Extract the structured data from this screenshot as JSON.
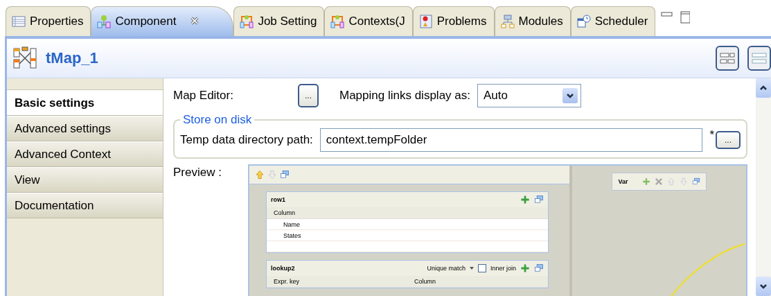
{
  "tabs": [
    {
      "label": "Properties",
      "kind": "table",
      "selected": false,
      "closable": false
    },
    {
      "label": "Component",
      "kind": "component",
      "selected": true,
      "closable": true
    },
    {
      "label": "Job Setting",
      "kind": "job",
      "selected": false,
      "closable": false
    },
    {
      "label": "Contexts(J",
      "kind": "job",
      "selected": false,
      "closable": false
    },
    {
      "label": "Problems",
      "kind": "problems",
      "selected": false,
      "closable": false
    },
    {
      "label": "Modules",
      "kind": "modules",
      "selected": false,
      "closable": false
    },
    {
      "label": "Scheduler",
      "kind": "scheduler",
      "selected": false,
      "closable": false
    }
  ],
  "title": "tMap_1",
  "sidebar": {
    "items": [
      {
        "label": "Basic settings",
        "selected": true
      },
      {
        "label": "Advanced settings",
        "selected": false
      },
      {
        "label": "Advanced Context",
        "selected": false
      },
      {
        "label": "View",
        "selected": false
      },
      {
        "label": "Documentation",
        "selected": false
      }
    ]
  },
  "settings": {
    "map_editor_label": "Map Editor:",
    "map_editor_button": "...",
    "mapping_label": "Mapping links display as:",
    "mapping_value": "Auto",
    "store_group": "Store on disk",
    "temp_label": "Temp data directory path:",
    "temp_value": "context.tempFolder",
    "required_mark": "*",
    "browse_button": "..."
  },
  "preview": {
    "label": "Preview :",
    "var_title": "Var",
    "tables": [
      {
        "kind": "main",
        "title": "row1",
        "columns": [
          "Column"
        ],
        "rows": [
          "Name",
          "States"
        ]
      },
      {
        "kind": "lookup",
        "title": "lookup2",
        "match": "Unique match",
        "inner_join": {
          "label": "Inner join",
          "checked": false
        },
        "columns": [
          "Expr. key",
          "Column"
        ]
      }
    ]
  }
}
